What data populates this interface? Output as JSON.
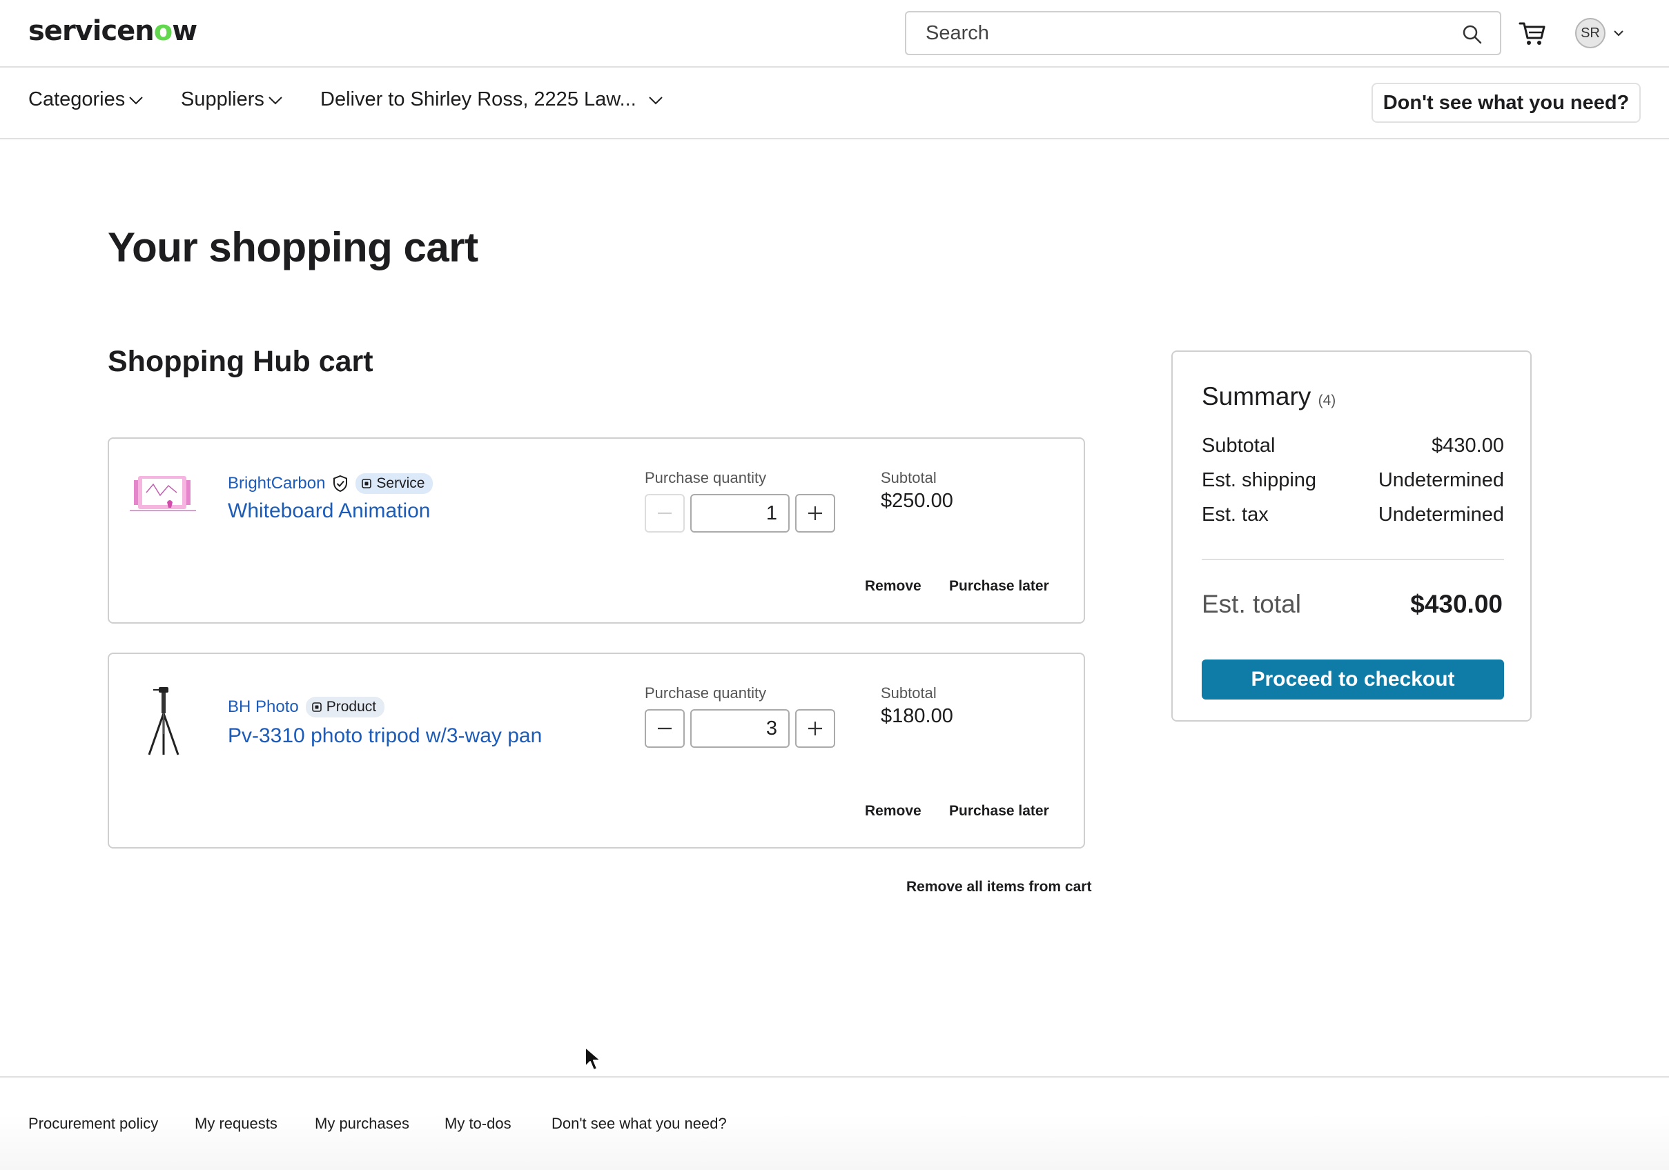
{
  "header": {
    "logo_prefix": "servicen",
    "logo_o": "o",
    "logo_suffix": "w",
    "search_placeholder": "Search",
    "avatar_initials": "SR"
  },
  "nav": {
    "categories": "Categories",
    "suppliers": "Suppliers",
    "deliver_to": "Deliver to Shirley Ross, 2225 Law...",
    "dont_see": "Don't see what you need?"
  },
  "page": {
    "title": "Your shopping cart",
    "section_title": "Shopping Hub cart",
    "remove_all": "Remove all items from cart"
  },
  "cart_items": [
    {
      "supplier": "BrightCarbon",
      "verified": true,
      "badge": "Service",
      "name": "Whiteboard Animation",
      "qty_label": "Purchase quantity",
      "quantity": "1",
      "decrement_disabled": true,
      "subtotal_label": "Subtotal",
      "subtotal": "$250.00",
      "remove_label": "Remove",
      "later_label": "Purchase later"
    },
    {
      "supplier": "BH Photo",
      "verified": false,
      "badge": "Product",
      "name": "Pv-3310 photo tripod w/3-way pan",
      "qty_label": "Purchase quantity",
      "quantity": "3",
      "decrement_disabled": false,
      "subtotal_label": "Subtotal",
      "subtotal": "$180.00",
      "remove_label": "Remove",
      "later_label": "Purchase later"
    }
  ],
  "summary": {
    "title": "Summary",
    "count": "(4)",
    "subtotal_label": "Subtotal",
    "subtotal_value": "$430.00",
    "shipping_label": "Est. shipping",
    "shipping_value": "Undetermined",
    "tax_label": "Est. tax",
    "tax_value": "Undetermined",
    "total_label": "Est. total",
    "total_value": "$430.00",
    "checkout_label": "Proceed to checkout"
  },
  "footer": {
    "links": [
      "Procurement policy",
      "My requests",
      "My purchases",
      "My to-dos",
      "Don't see what you need?"
    ]
  },
  "colors": {
    "link": "#1c5cb8",
    "primary_button": "#0f7ba7",
    "logo_accent": "#62d84e",
    "service_badge": "#dbe9f8"
  },
  "icons": {
    "search": "search-icon",
    "cart": "cart-icon",
    "chevron": "chevron-down-icon",
    "verified": "shield-check-icon",
    "badge": "tag-icon",
    "minus": "minus-icon",
    "plus": "plus-icon"
  }
}
